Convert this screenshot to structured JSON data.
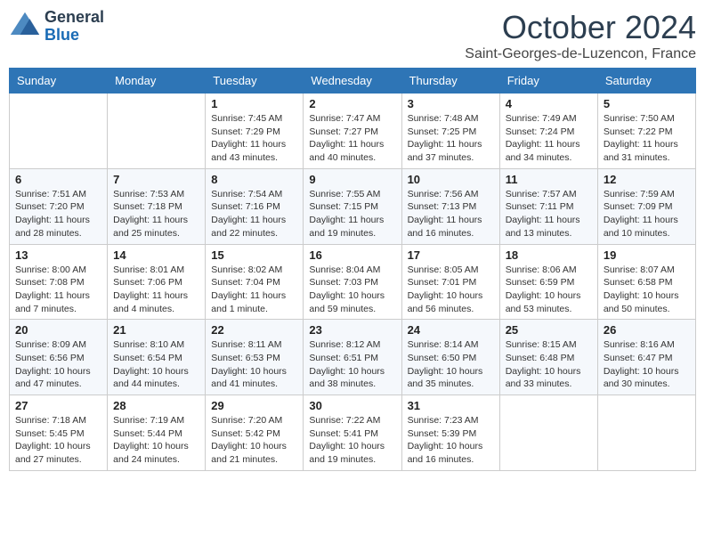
{
  "header": {
    "logo": {
      "general": "General",
      "blue": "Blue"
    },
    "title": "October 2024",
    "location": "Saint-Georges-de-Luzencon, France"
  },
  "weekdays": [
    "Sunday",
    "Monday",
    "Tuesday",
    "Wednesday",
    "Thursday",
    "Friday",
    "Saturday"
  ],
  "weeks": [
    [
      {
        "day": "",
        "info": ""
      },
      {
        "day": "",
        "info": ""
      },
      {
        "day": "1",
        "info": "Sunrise: 7:45 AM\nSunset: 7:29 PM\nDaylight: 11 hours and 43 minutes."
      },
      {
        "day": "2",
        "info": "Sunrise: 7:47 AM\nSunset: 7:27 PM\nDaylight: 11 hours and 40 minutes."
      },
      {
        "day": "3",
        "info": "Sunrise: 7:48 AM\nSunset: 7:25 PM\nDaylight: 11 hours and 37 minutes."
      },
      {
        "day": "4",
        "info": "Sunrise: 7:49 AM\nSunset: 7:24 PM\nDaylight: 11 hours and 34 minutes."
      },
      {
        "day": "5",
        "info": "Sunrise: 7:50 AM\nSunset: 7:22 PM\nDaylight: 11 hours and 31 minutes."
      }
    ],
    [
      {
        "day": "6",
        "info": "Sunrise: 7:51 AM\nSunset: 7:20 PM\nDaylight: 11 hours and 28 minutes."
      },
      {
        "day": "7",
        "info": "Sunrise: 7:53 AM\nSunset: 7:18 PM\nDaylight: 11 hours and 25 minutes."
      },
      {
        "day": "8",
        "info": "Sunrise: 7:54 AM\nSunset: 7:16 PM\nDaylight: 11 hours and 22 minutes."
      },
      {
        "day": "9",
        "info": "Sunrise: 7:55 AM\nSunset: 7:15 PM\nDaylight: 11 hours and 19 minutes."
      },
      {
        "day": "10",
        "info": "Sunrise: 7:56 AM\nSunset: 7:13 PM\nDaylight: 11 hours and 16 minutes."
      },
      {
        "day": "11",
        "info": "Sunrise: 7:57 AM\nSunset: 7:11 PM\nDaylight: 11 hours and 13 minutes."
      },
      {
        "day": "12",
        "info": "Sunrise: 7:59 AM\nSunset: 7:09 PM\nDaylight: 11 hours and 10 minutes."
      }
    ],
    [
      {
        "day": "13",
        "info": "Sunrise: 8:00 AM\nSunset: 7:08 PM\nDaylight: 11 hours and 7 minutes."
      },
      {
        "day": "14",
        "info": "Sunrise: 8:01 AM\nSunset: 7:06 PM\nDaylight: 11 hours and 4 minutes."
      },
      {
        "day": "15",
        "info": "Sunrise: 8:02 AM\nSunset: 7:04 PM\nDaylight: 11 hours and 1 minute."
      },
      {
        "day": "16",
        "info": "Sunrise: 8:04 AM\nSunset: 7:03 PM\nDaylight: 10 hours and 59 minutes."
      },
      {
        "day": "17",
        "info": "Sunrise: 8:05 AM\nSunset: 7:01 PM\nDaylight: 10 hours and 56 minutes."
      },
      {
        "day": "18",
        "info": "Sunrise: 8:06 AM\nSunset: 6:59 PM\nDaylight: 10 hours and 53 minutes."
      },
      {
        "day": "19",
        "info": "Sunrise: 8:07 AM\nSunset: 6:58 PM\nDaylight: 10 hours and 50 minutes."
      }
    ],
    [
      {
        "day": "20",
        "info": "Sunrise: 8:09 AM\nSunset: 6:56 PM\nDaylight: 10 hours and 47 minutes."
      },
      {
        "day": "21",
        "info": "Sunrise: 8:10 AM\nSunset: 6:54 PM\nDaylight: 10 hours and 44 minutes."
      },
      {
        "day": "22",
        "info": "Sunrise: 8:11 AM\nSunset: 6:53 PM\nDaylight: 10 hours and 41 minutes."
      },
      {
        "day": "23",
        "info": "Sunrise: 8:12 AM\nSunset: 6:51 PM\nDaylight: 10 hours and 38 minutes."
      },
      {
        "day": "24",
        "info": "Sunrise: 8:14 AM\nSunset: 6:50 PM\nDaylight: 10 hours and 35 minutes."
      },
      {
        "day": "25",
        "info": "Sunrise: 8:15 AM\nSunset: 6:48 PM\nDaylight: 10 hours and 33 minutes."
      },
      {
        "day": "26",
        "info": "Sunrise: 8:16 AM\nSunset: 6:47 PM\nDaylight: 10 hours and 30 minutes."
      }
    ],
    [
      {
        "day": "27",
        "info": "Sunrise: 7:18 AM\nSunset: 5:45 PM\nDaylight: 10 hours and 27 minutes."
      },
      {
        "day": "28",
        "info": "Sunrise: 7:19 AM\nSunset: 5:44 PM\nDaylight: 10 hours and 24 minutes."
      },
      {
        "day": "29",
        "info": "Sunrise: 7:20 AM\nSunset: 5:42 PM\nDaylight: 10 hours and 21 minutes."
      },
      {
        "day": "30",
        "info": "Sunrise: 7:22 AM\nSunset: 5:41 PM\nDaylight: 10 hours and 19 minutes."
      },
      {
        "day": "31",
        "info": "Sunrise: 7:23 AM\nSunset: 5:39 PM\nDaylight: 10 hours and 16 minutes."
      },
      {
        "day": "",
        "info": ""
      },
      {
        "day": "",
        "info": ""
      }
    ]
  ]
}
